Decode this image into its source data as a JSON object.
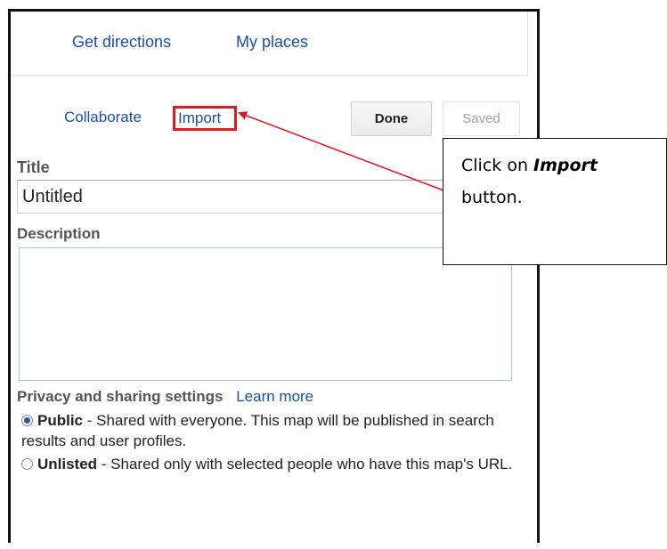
{
  "nav": {
    "get_directions": "Get directions",
    "my_places": "My places"
  },
  "toolbar": {
    "collaborate": "Collaborate",
    "import": "Import",
    "done": "Done",
    "saved": "Saved"
  },
  "form": {
    "title_label": "Title",
    "title_value": "Untitled",
    "description_label": "Description",
    "description_value": ""
  },
  "privacy": {
    "heading": "Privacy and sharing settings",
    "learn_more": "Learn more",
    "public_label": "Public",
    "public_desc": " - Shared with everyone. This map will be published in search results and user profiles.",
    "unlisted_label": "Unlisted",
    "unlisted_desc": " - Shared only with selected people who have this map's URL.",
    "selected": "Public"
  },
  "callout": {
    "prefix": "Click on ",
    "emphasis": "Import",
    "suffix": " button."
  },
  "colors": {
    "link": "#1a4fb0",
    "highlight": "#e01a22",
    "radio_selected": "#2d55b3"
  }
}
